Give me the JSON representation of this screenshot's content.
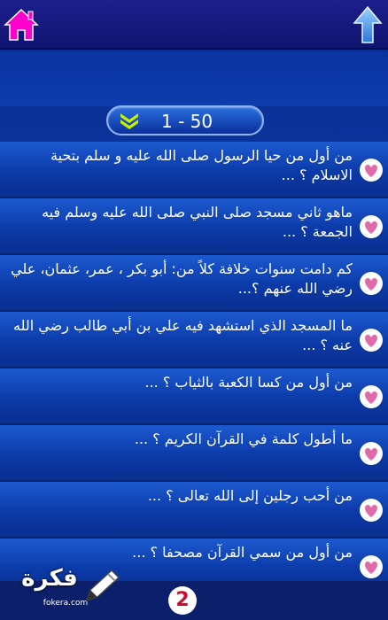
{
  "colors": {
    "accent": "#ff00cc",
    "arrow": "#3b8fe8",
    "chevron": "#c6f000",
    "heart": "#e06aa5",
    "badge_text": "#c8102e"
  },
  "topbar": {
    "home_icon": "home-icon",
    "up_icon": "up-arrow-icon"
  },
  "range": {
    "label": "1 - 50",
    "icon": "double-chevron-down-icon"
  },
  "questions": [
    {
      "text": "من أول من حيا الرسول صلى الله عليه و سلم بتحية الاسلام ؟ ..."
    },
    {
      "text": "ماهو ثاني مسجد صلى النبي صلى الله عليه وسلم فيه الجمعة ؟ ..."
    },
    {
      "text": "كم دامت سنوات خلافة كلاً من: أبو بكر ، عمر، عثمان، علي رضي الله عنهم ؟..."
    },
    {
      "text": "ما المسجد الذي استشهد فيه علي بن أبي طالب رضي الله عنه ؟ ..."
    },
    {
      "text": "من أول من كسا الكعبة بالثياب ؟ ..."
    },
    {
      "text": "ما أطول كلمة في القرآن الكريم ؟ ..."
    },
    {
      "text": "من أحب رجلين إلى الله تعالى ؟ ..."
    },
    {
      "text": "من أول من سمي القرآن مصحفا ؟ ..."
    }
  ],
  "badge": {
    "number": "2"
  },
  "watermark": {
    "brand": "فكرة",
    "url": "fokera.com"
  }
}
